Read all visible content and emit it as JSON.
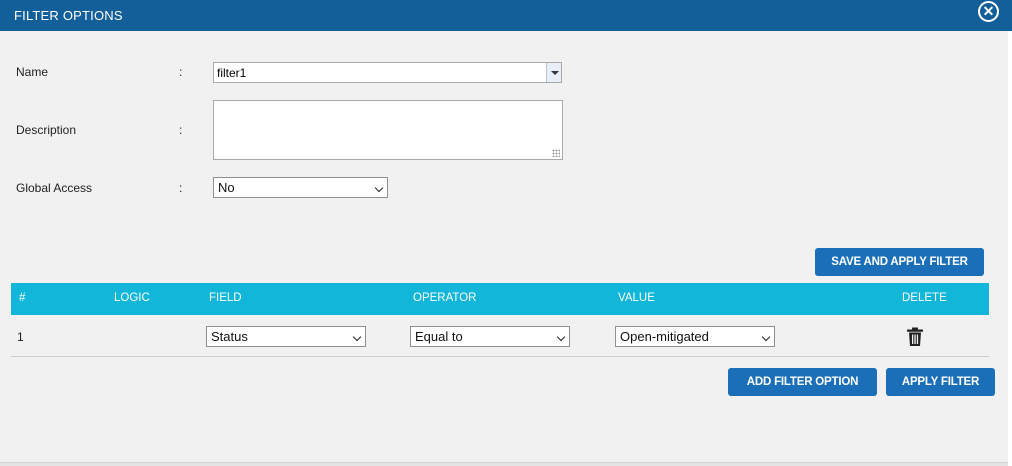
{
  "dialog": {
    "title": "FILTER OPTIONS",
    "close_glyph": "✕",
    "close_icon": "close-circle-icon"
  },
  "form": {
    "name": {
      "label": "Name",
      "colon": ":",
      "value": "filter1"
    },
    "description": {
      "label": "Description",
      "colon": ":",
      "value": ""
    },
    "global_access": {
      "label": "Global Access",
      "colon": ":",
      "value": "No"
    }
  },
  "buttons": {
    "save_and_apply": "SAVE AND APPLY FILTER",
    "add_filter_option": "ADD FILTER OPTION",
    "apply_filter": "APPLY FILTER"
  },
  "table": {
    "headers": [
      "#",
      "LOGIC",
      "FIELD",
      "OPERATOR",
      "VALUE",
      "DELETE"
    ],
    "rows": [
      {
        "num": "1",
        "logic": "",
        "field": "Status",
        "operator": "Equal to",
        "value": "Open-mitigated",
        "delete_icon": "trash-icon"
      }
    ]
  },
  "colors": {
    "titlebar": "#135f99",
    "table_header": "#12b6d9",
    "button": "#1a6fb8",
    "background": "#f1f1f1"
  }
}
